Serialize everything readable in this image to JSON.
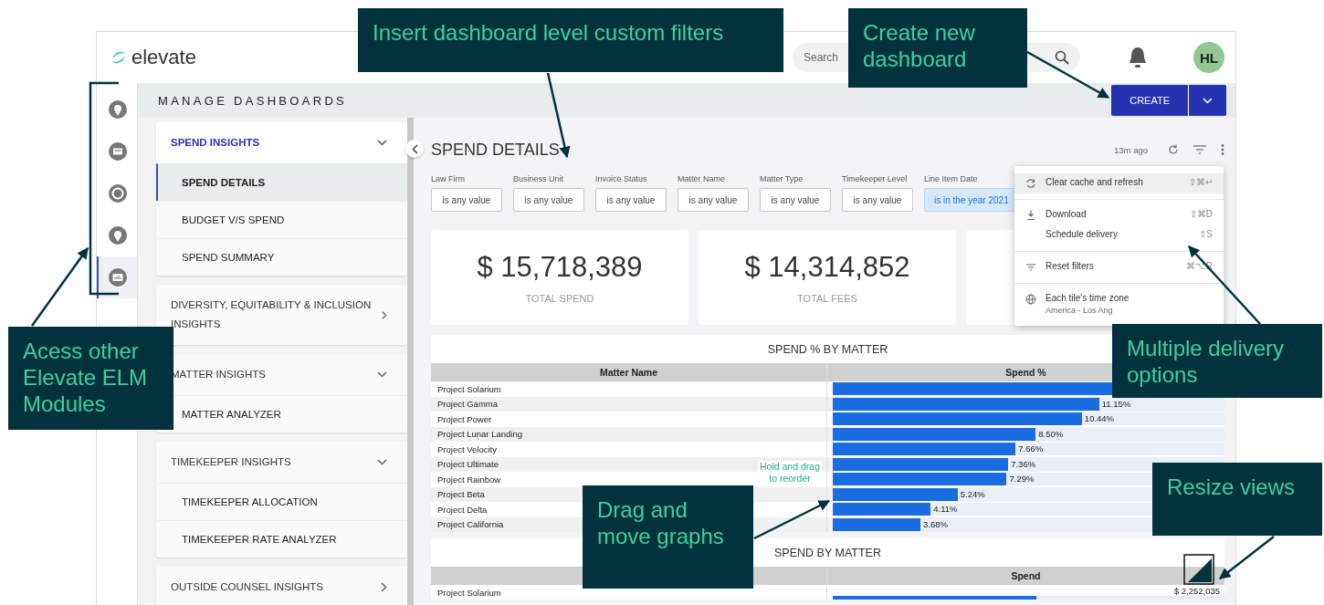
{
  "app": {
    "logo": "elevate",
    "search": {
      "placeholder": "Search"
    },
    "avatar": "HL",
    "page_title": "MANAGE DASHBOARDS",
    "create_button": "CREATE"
  },
  "module_rail": [
    {
      "kind": "pin",
      "selected": false
    },
    {
      "kind": "card",
      "selected": false
    },
    {
      "kind": "ring",
      "selected": false
    },
    {
      "kind": "pin",
      "selected": false
    },
    {
      "kind": "chart",
      "selected": true
    }
  ],
  "nav_groups": [
    {
      "label": "SPEND INSIGHTS",
      "selected": true,
      "expanded": true,
      "children": [
        {
          "label": "SPEND DETAILS",
          "selected": true
        },
        {
          "label": "BUDGET V/S SPEND",
          "selected": false
        },
        {
          "label": "SPEND SUMMARY",
          "selected": false
        }
      ]
    },
    {
      "label": "DIVERSITY, EQUITABILITY & INCLUSION INSIGHTS",
      "selected": false,
      "expanded": false
    },
    {
      "label": "MATTER INSIGHTS",
      "selected": false,
      "expanded": true,
      "children": [
        {
          "label": "MATTER ANALYZER",
          "selected": false
        }
      ]
    },
    {
      "label": "TIMEKEEPER INSIGHTS",
      "selected": false,
      "expanded": true,
      "children": [
        {
          "label": "TIMEKEEPER ALLOCATION",
          "selected": false
        },
        {
          "label": "TIMEKEEPER RATE ANALYZER",
          "selected": false
        }
      ]
    },
    {
      "label": "OUTSIDE COUNSEL INSIGHTS",
      "selected": false,
      "expanded": false
    }
  ],
  "dashboard": {
    "title": "SPEND DETAILS",
    "updated": "13m ago",
    "filters": [
      {
        "label": "Law Firm",
        "value": "is any value",
        "active": false
      },
      {
        "label": "Business Unit",
        "value": "is any value",
        "active": false
      },
      {
        "label": "Invoice Status",
        "value": "is any value",
        "active": false
      },
      {
        "label": "Matter Name",
        "value": "is any value",
        "active": false
      },
      {
        "label": "Matter Type",
        "value": "is any value",
        "active": false
      },
      {
        "label": "Timekeeper Level",
        "value": "is any value",
        "active": false
      },
      {
        "label": "Line Item Date",
        "value": "is in the year 2021",
        "active": true
      }
    ],
    "kpis": [
      {
        "value": "$ 15,718,389",
        "label": "TOTAL SPEND"
      },
      {
        "value": "$ 14,314,852",
        "label": "TOTAL FEES"
      }
    ],
    "spend_pct_tile": {
      "title": "SPEND % BY MATTER",
      "columns": [
        "Matter Name",
        "Spend %"
      ],
      "rows": [
        {
          "matter": "Project Solarium",
          "level": 0.8
        },
        {
          "matter": "Project Gamma",
          "spend_pct": "11.15%",
          "level": 0.68
        },
        {
          "matter": "Project Power",
          "spend_pct": "10.44%",
          "level": 0.636
        },
        {
          "matter": "Project Lunar Landing",
          "spend_pct": "8.50%",
          "level": 0.518
        },
        {
          "matter": "Project Velocity",
          "spend_pct": "7.66%",
          "level": 0.467
        },
        {
          "matter": "Project Ultimate",
          "spend_pct": "7.36%",
          "level": 0.448
        },
        {
          "matter": "Project Rainbow",
          "spend_pct": "7.29%",
          "level": 0.444
        },
        {
          "matter": "Project Beta",
          "spend_pct": "5.24%",
          "level": 0.319
        },
        {
          "matter": "Project Delta",
          "spend_pct": "4.11%",
          "level": 0.25
        },
        {
          "matter": "Project California",
          "spend_pct": "3.68%",
          "level": 0.224
        }
      ]
    },
    "spend_tile": {
      "title": "SPEND BY MATTER",
      "column_2": "Spend",
      "rows": [
        {
          "matter": "Project Solarium",
          "spend": "$ 2,252,035",
          "level": 0.52
        }
      ]
    }
  },
  "menu": {
    "sections": [
      {
        "items": [
          {
            "kind": "refresh",
            "label": "Clear cache and refresh",
            "shortcut": "⇧⌘↵",
            "highlighted": true
          }
        ]
      },
      {
        "items": [
          {
            "kind": "download",
            "label": "Download",
            "shortcut": "⇧⌘D",
            "highlighted": false
          },
          {
            "kind": "plain",
            "label": "Schedule delivery",
            "shortcut": "⇧S",
            "highlighted": false
          }
        ]
      },
      {
        "items": [
          {
            "kind": "filter",
            "label": "Reset filters",
            "shortcut": "⌘⌥R",
            "highlighted": false
          }
        ]
      },
      {
        "items": [
          {
            "kind": "globe",
            "label": "Each tile's time zone",
            "sublabel": "America - Los Ang",
            "highlighted": false
          }
        ]
      }
    ]
  },
  "annotations": [
    {
      "text": "Insert dashboard level custom filters"
    },
    {
      "text": "Create new dashboard"
    },
    {
      "text": "Acess other Elevate ELM Modules"
    },
    {
      "text": "Multiple delivery options"
    },
    {
      "text": "Drag and move graphs"
    },
    {
      "text": "Resize views"
    }
  ],
  "hint": "Hold and drag to reorder"
}
